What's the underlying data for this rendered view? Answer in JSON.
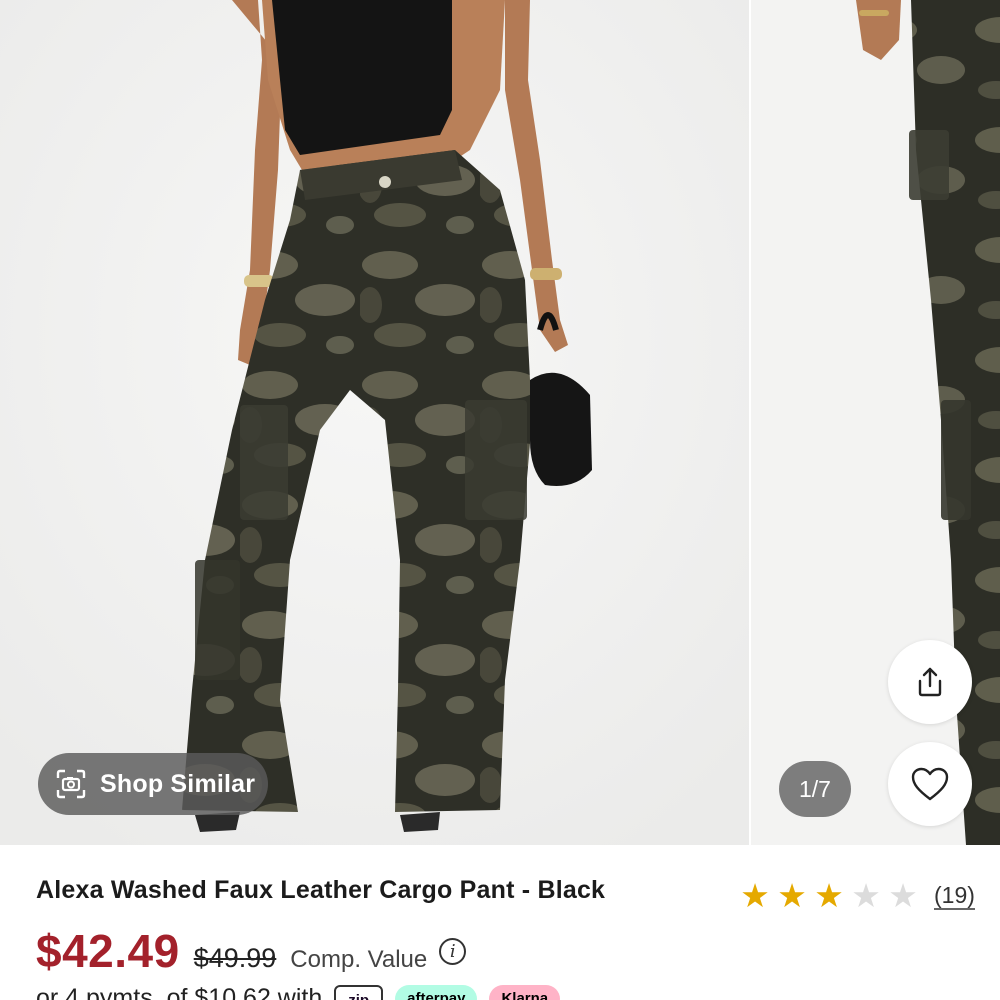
{
  "gallery": {
    "shop_similar_label": "Shop Similar",
    "counter": "1/7"
  },
  "product": {
    "title": "Alexa Washed Faux Leather Cargo Pant - Black",
    "rating": 3,
    "rating_max": 5,
    "review_count": "(19)",
    "price": "$42.49",
    "compare_price": "$49.99",
    "compare_label": "Comp. Value",
    "installments_text": "or 4 pymts. of $10.62 with",
    "payment_badges": [
      "zip",
      "afterpay",
      "Klarna"
    ]
  },
  "colors": {
    "sale_price": "#a3212b",
    "star_filled": "#e5a900",
    "star_empty": "#dcdcdc"
  },
  "icons": {
    "shop_similar": "camera-scan-icon",
    "share": "share-icon",
    "favorite": "heart-icon",
    "info": "info-icon"
  }
}
